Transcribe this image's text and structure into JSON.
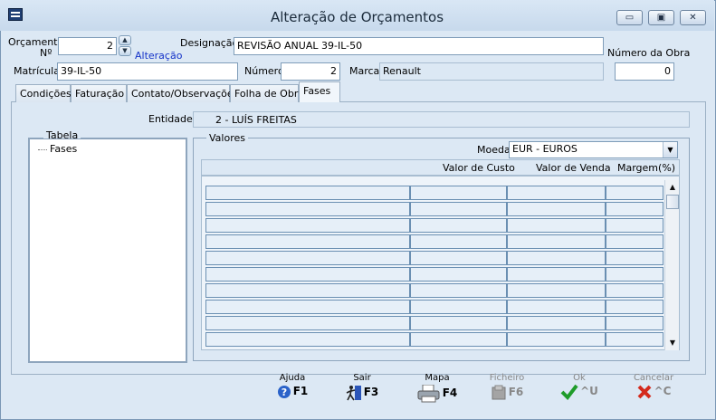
{
  "window": {
    "title": "Alteração de Orçamentos",
    "minimize": "▭",
    "maximize": "▣",
    "close": "✕"
  },
  "header": {
    "orcamento_label_1": "Orçamento",
    "orcamento_label_2": "Nº",
    "orcamento_value": "2",
    "alteracao": "Alteração",
    "designacao_label": "Designação",
    "designacao_value": "REVISÃO ANUAL 39-IL-50",
    "numero_obra_label": "Número da Obra",
    "numero_obra_value": "0",
    "matricula_label": "Matrícula",
    "matricula_value": "39-IL-50",
    "numero_label": "Número",
    "numero_value": "2",
    "marca_label": "Marca",
    "marca_value": "Renault"
  },
  "tabs": [
    {
      "label": "Condições"
    },
    {
      "label": "Faturação"
    },
    {
      "label": "Contato/Observações"
    },
    {
      "label": "Folha de Obra"
    },
    {
      "label": "Fases"
    }
  ],
  "fases": {
    "entidade_label": "Entidade",
    "entidade_value": "2 - LUÍS FREITAS",
    "tabela_title": "Tabela",
    "tree_item": "Fases",
    "valores_title": "Valores",
    "moeda_label": "Moeda",
    "moeda_value": "EUR - EUROS",
    "columns": [
      "Valor de Custo",
      "Valor de Venda",
      "Margem(%)"
    ]
  },
  "buttons": {
    "ajuda": {
      "caption": "Ajuda",
      "key": "F1"
    },
    "sair": {
      "caption": "Sair",
      "key": "F3"
    },
    "mapa": {
      "caption": "Mapa",
      "key": "F4"
    },
    "ficheiro": {
      "caption": "Ficheiro",
      "key": "F6"
    },
    "ok": {
      "caption": "Ok",
      "key": "^U"
    },
    "cancelar": {
      "caption": "Cancelar",
      "key": "^C"
    }
  },
  "colors": {
    "accent_blue": "#1432c8",
    "window_bg": "#dce8f4",
    "grid_cell_border": "#6a8fb2"
  }
}
